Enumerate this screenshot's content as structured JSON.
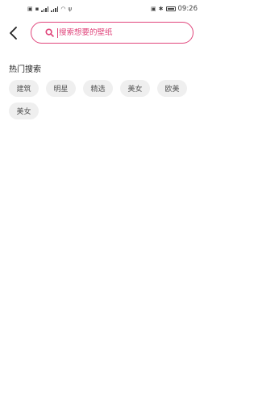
{
  "status_bar": {
    "left_icons": [
      "sim-icon",
      "nfc-icon",
      "signal-4g-icon",
      "signal-2g-icon",
      "wifi-icon",
      "usb-icon"
    ],
    "right_icons": [
      "nfc-icon",
      "bluetooth-icon",
      "battery-icon"
    ],
    "time": "09:26"
  },
  "search": {
    "placeholder": "搜索想要的壁纸",
    "value": "",
    "accent_color": "#e0457b"
  },
  "hot": {
    "title": "热门搜索",
    "tags": [
      "建筑",
      "明星",
      "精选",
      "美女",
      "欧美",
      "美女"
    ]
  }
}
